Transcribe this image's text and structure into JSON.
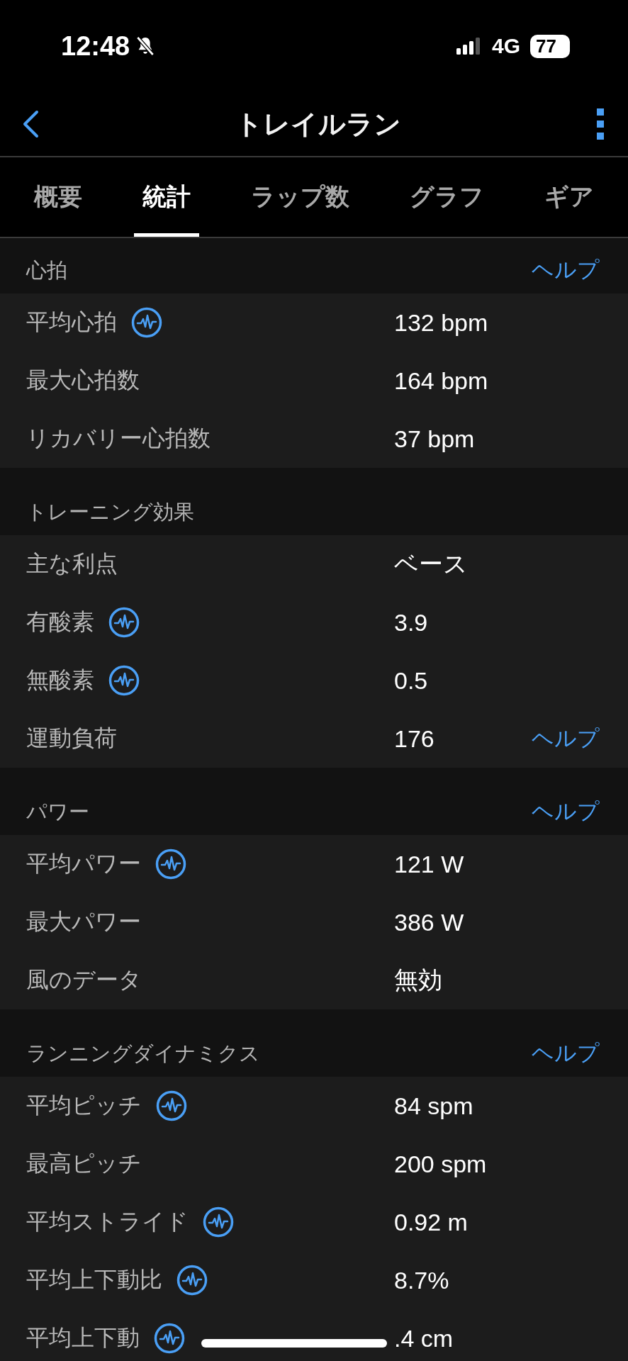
{
  "status_bar": {
    "time": "12:48",
    "silent": true,
    "network": "4G",
    "battery": "77"
  },
  "header": {
    "title": "トレイルラン"
  },
  "tabs": [
    {
      "label": "概要",
      "selected": false
    },
    {
      "label": "統計",
      "selected": true
    },
    {
      "label": "ラップ数",
      "selected": false
    },
    {
      "label": "グラフ",
      "selected": false
    },
    {
      "label": "ギア",
      "selected": false
    }
  ],
  "sections": [
    {
      "title": "心拍",
      "help": "ヘルプ",
      "rows": [
        {
          "label": "平均心拍",
          "chart_icon": true,
          "value": "132 bpm"
        },
        {
          "label": "最大心拍数",
          "chart_icon": false,
          "value": "164 bpm"
        },
        {
          "label": "リカバリー心拍数",
          "chart_icon": false,
          "value": "37 bpm"
        }
      ]
    },
    {
      "title": "トレーニング効果",
      "rows": [
        {
          "label": "主な利点",
          "chart_icon": false,
          "value": "ベース"
        },
        {
          "label": "有酸素",
          "chart_icon": true,
          "value": "3.9"
        },
        {
          "label": "無酸素",
          "chart_icon": true,
          "value": "0.5"
        },
        {
          "label": "運動負荷",
          "chart_icon": false,
          "value": "176",
          "help": "ヘルプ"
        }
      ]
    },
    {
      "title": "パワー",
      "help": "ヘルプ",
      "rows": [
        {
          "label": "平均パワー",
          "chart_icon": true,
          "value": "121 W"
        },
        {
          "label": "最大パワー",
          "chart_icon": false,
          "value": "386 W"
        },
        {
          "label": "風のデータ",
          "chart_icon": false,
          "value": "無効"
        }
      ]
    },
    {
      "title": "ランニングダイナミクス",
      "help": "ヘルプ",
      "rows": [
        {
          "label": "平均ピッチ",
          "chart_icon": true,
          "value": "84 spm"
        },
        {
          "label": "最高ピッチ",
          "chart_icon": false,
          "value": "200 spm"
        },
        {
          "label": "平均ストライド",
          "chart_icon": true,
          "value": "0.92 m"
        },
        {
          "label": "平均上下動比",
          "chart_icon": true,
          "value": "8.7%"
        },
        {
          "label": "平均上下動",
          "chart_icon": true,
          "value": ".4 cm"
        }
      ]
    }
  ]
}
